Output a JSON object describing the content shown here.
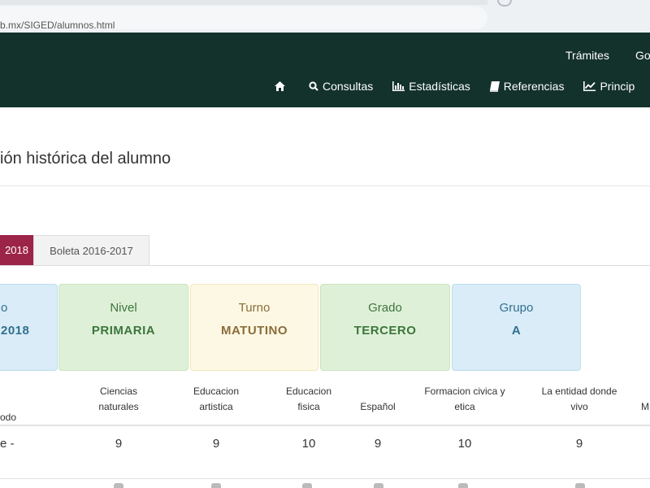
{
  "browser": {
    "url": "b.mx/SIGED/alumnos.html"
  },
  "header": {
    "bg_color": "#13322b",
    "top_links": [
      "Trámites",
      "Go"
    ],
    "main_nav": [
      {
        "label": "",
        "icon": "home-icon"
      },
      {
        "label": "Consultas",
        "icon": "search-icon"
      },
      {
        "label": "Estadísticas",
        "icon": "bar-chart-icon"
      },
      {
        "label": "Referencias",
        "icon": "book-icon"
      },
      {
        "label": "Princip",
        "icon": "line-chart-icon"
      }
    ]
  },
  "page": {
    "title": "ión histórica del alumno"
  },
  "tabs": [
    {
      "label": "2018",
      "active": true,
      "color": "#9d2449"
    },
    {
      "label": "Boleta 2016-2017",
      "active": false
    }
  ],
  "cards": [
    {
      "label": "o",
      "value": "2018",
      "color": "blue"
    },
    {
      "label": "Nivel",
      "value": "PRIMARIA",
      "color": "green"
    },
    {
      "label": "Turno",
      "value": "MATUTINO",
      "color": "yellow"
    },
    {
      "label": "Grado",
      "value": "TERCERO",
      "color": "green"
    },
    {
      "label": "Grupo",
      "value": "A",
      "color": "blue"
    }
  ],
  "grades_table": {
    "headers": [
      "odo",
      "Ciencias\nnaturales",
      "Educacion\nartistica",
      "Educacion\nfisica",
      "Español",
      "Formacion civica y\netica",
      "La entidad donde\nvivo",
      "M"
    ],
    "rows": [
      [
        "e -",
        "9",
        "9",
        "10",
        "9",
        "10",
        "9",
        ""
      ]
    ]
  }
}
